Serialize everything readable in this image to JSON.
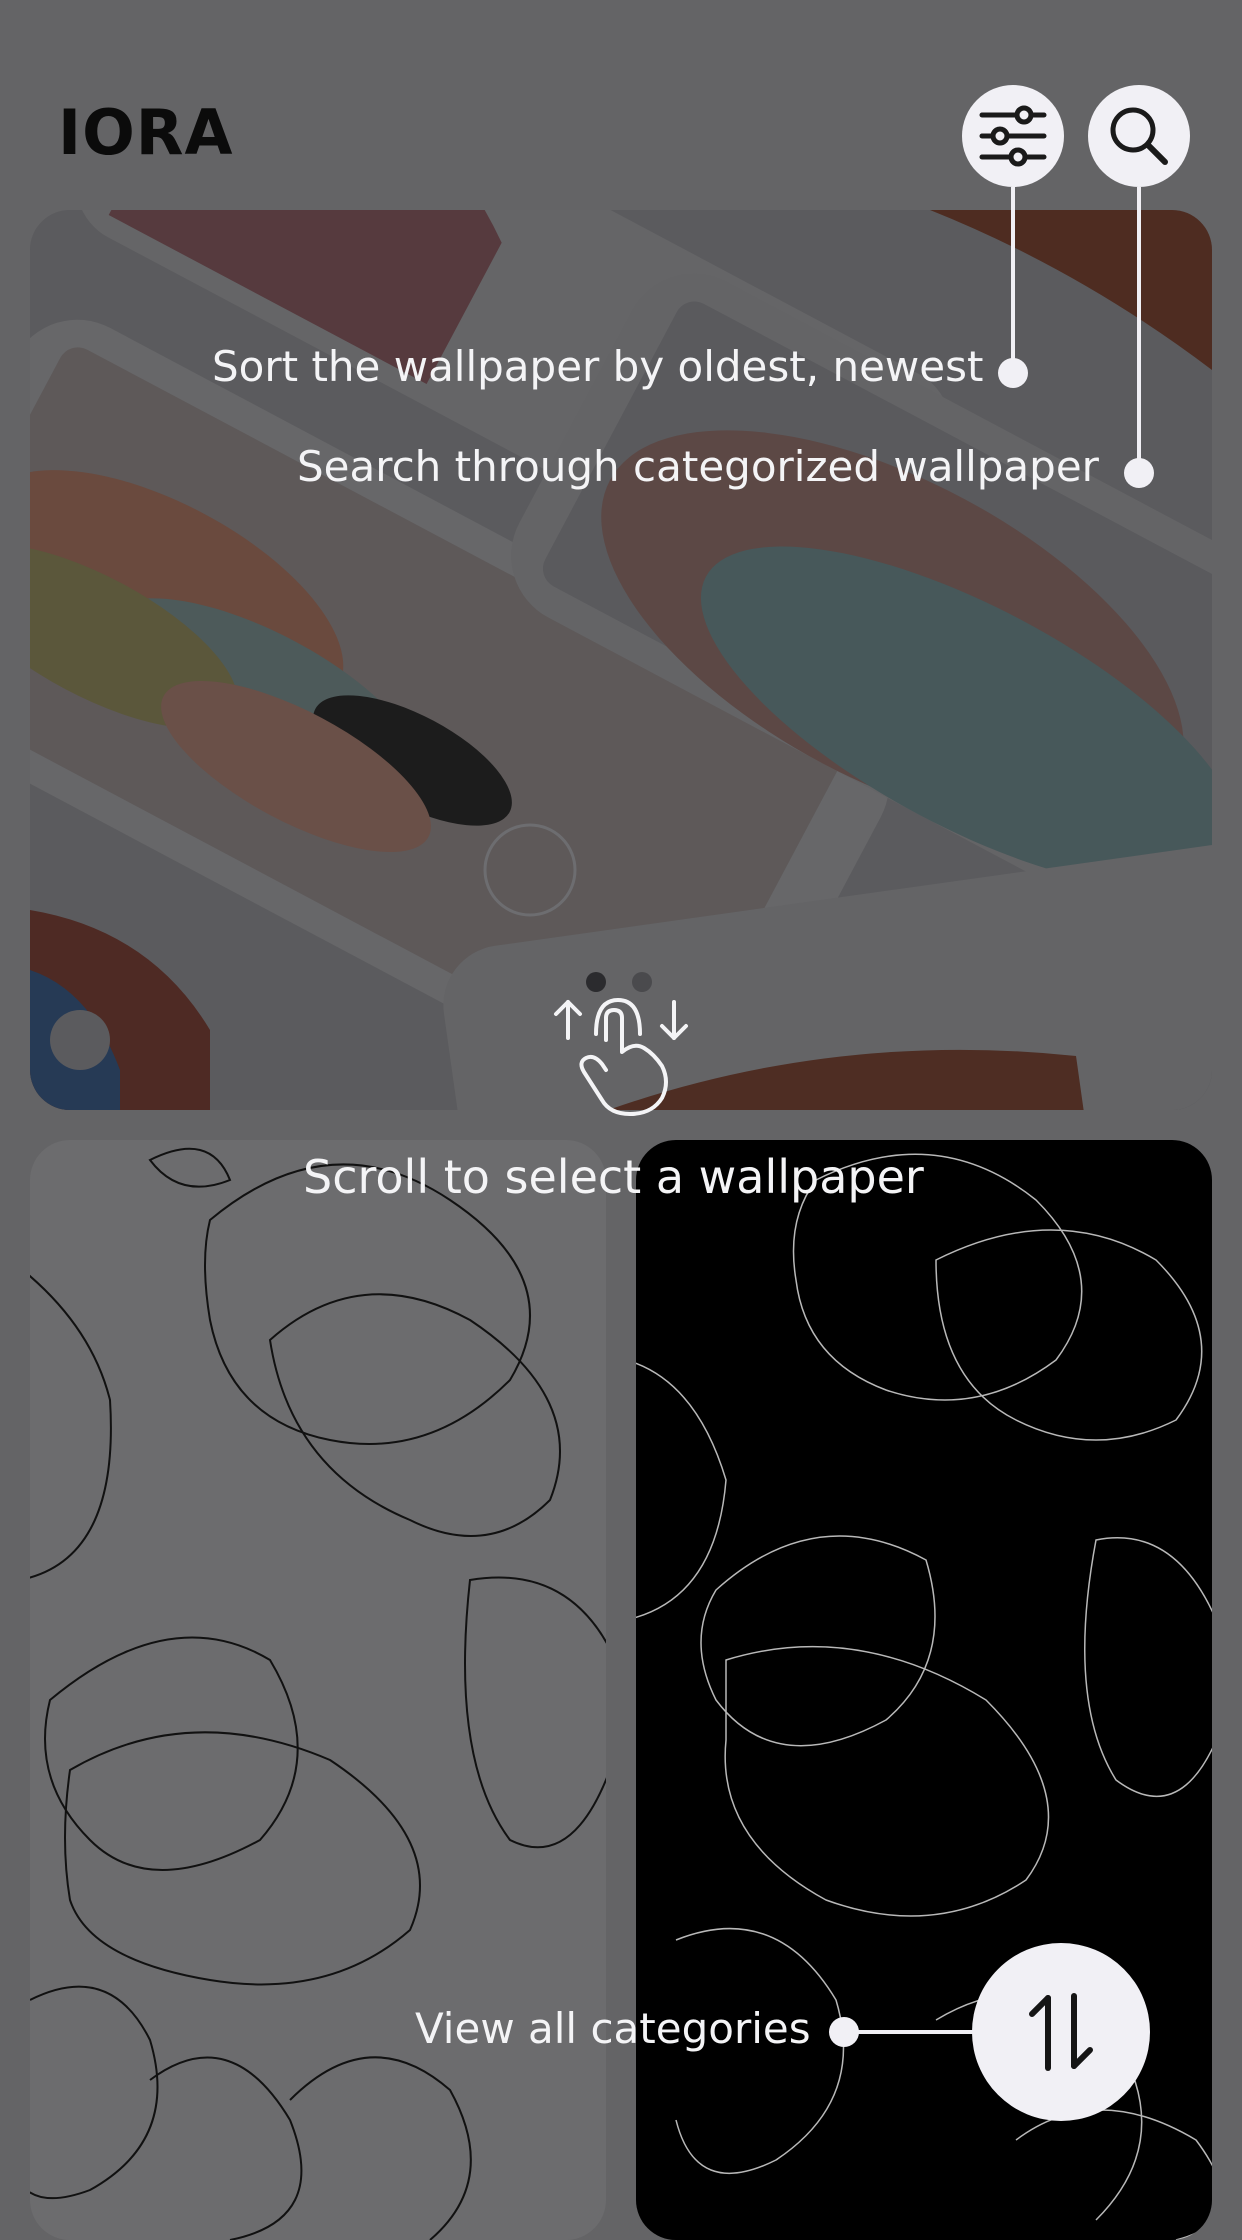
{
  "app": {
    "title": "IORA"
  },
  "header": {
    "filter_icon": "sliders-icon",
    "search_icon": "search-icon"
  },
  "carousel": {
    "page_count": 2,
    "active_index": 0
  },
  "tips": {
    "sort": "Sort the wallpaper by oldest, newest",
    "search": "Search through categorized wallpaper",
    "scroll": "Scroll to select a wallpaper",
    "categories": "View all categories"
  },
  "fab": {
    "icon": "swap-vertical-icon"
  },
  "colors": {
    "overlay": "#646466",
    "button_bg": "#f1f0f5",
    "tip_text": "#f4f4f6"
  }
}
